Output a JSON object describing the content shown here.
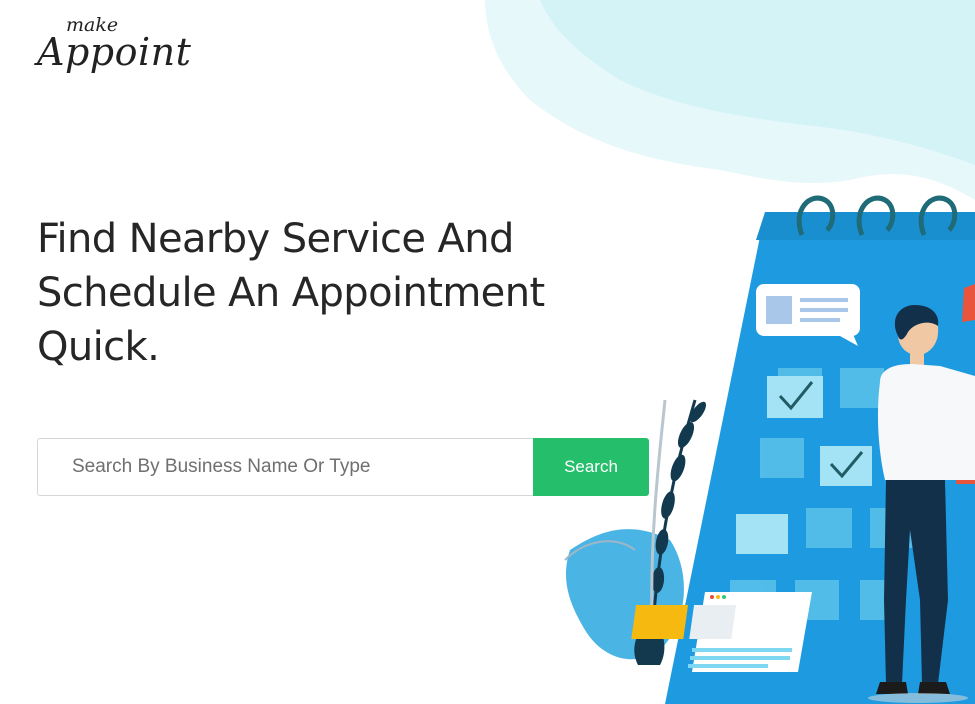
{
  "brand": {
    "small": "make",
    "big": "Appoint"
  },
  "hero": {
    "title_lines": [
      "Find Nearby Service And",
      "Schedule An Appointment",
      "Quick."
    ]
  },
  "search": {
    "placeholder": "Search By Business Name Or Type",
    "value": "",
    "button_label": "Search"
  },
  "colors": {
    "accent": "#25bf6c",
    "calendar_blue": "#1e9be0",
    "blob": "#d4f3f7",
    "text": "#262626"
  },
  "icons": [
    "calendar-illustration",
    "person-illustration",
    "plant-illustration",
    "chat-bubble-icon",
    "checkmark-icon",
    "browser-window-icon"
  ]
}
